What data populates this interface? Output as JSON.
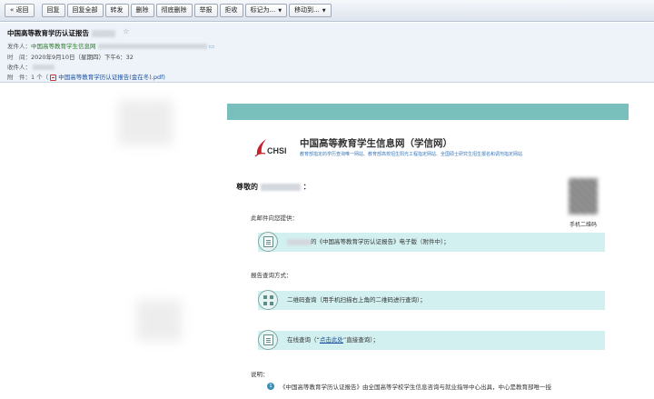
{
  "toolbar": {
    "back": "« 返回",
    "reply": "回复",
    "reply_all": "回复全部",
    "forward": "转发",
    "delete": "删除",
    "delete_permanent": "彻底删除",
    "report": "举报",
    "reject": "拒收",
    "mark_as": "标记为...",
    "move_to": "移动到..."
  },
  "header": {
    "subject": "中国高等教育学历认证报告",
    "sender_label": "发件人：",
    "sender_name": "中国高等教育学生信息网",
    "time_label": "时　间：",
    "time_value": "2020年9月10日（星期四）下午6：32",
    "recipient_label": "收件人：",
    "attachment_label": "附　件：",
    "attachment_count": "1 个（",
    "attachment_name": "中国高等教育学历认证报告(金在冬).pdf)"
  },
  "mail": {
    "logo_text": "CHSI",
    "brand_title": "中国高等教育学生信息网（学信网）",
    "tagline": "教育部指定的学历查询唯一网站、教育部高校招生阳光工程指定网站、全国硕士研究生招生报名和调剂指定网站",
    "greeting_prefix": "尊敬的",
    "greeting_suffix": "：",
    "qr_label": "手机二维码",
    "provided_heading": "此邮件向您提供：",
    "provided_item": "的《中国高等教育学历认证报告》电子版（附件中）；",
    "methods_heading": "报告查询方式：",
    "method_qr": "二维码查询（用手机扫描右上角的二维码进行查询）；",
    "method_online_prefix": "在线查询（“",
    "method_online_link": "点击此处",
    "method_online_suffix": "”直接查询）；",
    "notes_heading": "说明：",
    "note_number": "1",
    "note_text": "《中国高等教育学历认证报告》由全国高等学校学生信息咨询与就业指导中心出具，中心是教育部唯一授"
  },
  "colors": {
    "accent_bar": "#79c0bd",
    "info_bar": "#d2f0f0",
    "link": "#1a4f9c",
    "sender": "#2d7a2d"
  }
}
